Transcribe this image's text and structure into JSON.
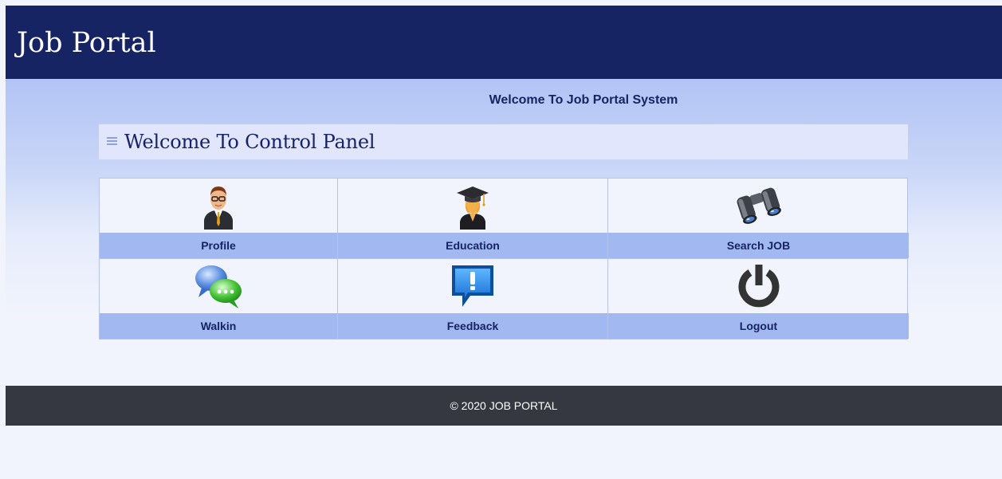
{
  "app": {
    "title": "Job Portal"
  },
  "welcome": {
    "system_text": "Welcome To Job Portal System",
    "panel_title": "Welcome To Control Panel"
  },
  "tiles": [
    {
      "label": "Profile",
      "icon": "profile-person-icon"
    },
    {
      "label": "Education",
      "icon": "graduation-icon"
    },
    {
      "label": "Search JOB",
      "icon": "binoculars-icon"
    },
    {
      "label": "Walkin",
      "icon": "chat-bubbles-icon"
    },
    {
      "label": "Feedback",
      "icon": "feedback-exclamation-icon"
    },
    {
      "label": "Logout",
      "icon": "power-icon"
    }
  ],
  "footer": {
    "text": "© 2020 JOB PORTAL"
  },
  "colors": {
    "header": "#172464",
    "label_bar": "#a1b8f1",
    "footer": "#353840"
  }
}
